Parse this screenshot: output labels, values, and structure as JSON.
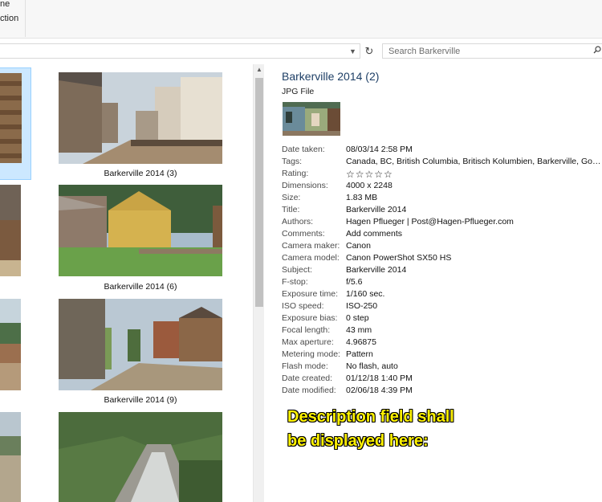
{
  "ribbon": {
    "cmd_top": "ne",
    "cmd_bottom": "ction"
  },
  "search": {
    "placeholder": "Search Barkerville",
    "icon": "search-icon"
  },
  "thumbnails": [
    {
      "caption": "Barkerville 2014 (3)"
    },
    {
      "caption": "Barkerville 2014 (6)"
    },
    {
      "caption": "Barkerville 2014 (9)"
    }
  ],
  "details": {
    "title": "Barkerville 2014 (2)",
    "type": "JPG File",
    "properties": [
      {
        "label": "Date taken:",
        "value": "08/03/14 2:58 PM"
      },
      {
        "label": "Tags:",
        "value": "Canada, BC, British Columbia, Britisch Kolumbien, Barkerville, Gold, Go..."
      },
      {
        "label": "Rating:",
        "value": "☆☆☆☆☆"
      },
      {
        "label": "Dimensions:",
        "value": "4000 x 2248"
      },
      {
        "label": "Size:",
        "value": "1.83 MB"
      },
      {
        "label": "Title:",
        "value": "Barkerville 2014"
      },
      {
        "label": "Authors:",
        "value": "Hagen Pflueger | Post@Hagen-Pflueger.com"
      },
      {
        "label": "Comments:",
        "value": "Add comments"
      },
      {
        "label": "Camera maker:",
        "value": "Canon"
      },
      {
        "label": "Camera model:",
        "value": "Canon PowerShot SX50 HS"
      },
      {
        "label": "Subject:",
        "value": "Barkerville 2014"
      },
      {
        "label": "F-stop:",
        "value": "f/5.6"
      },
      {
        "label": "Exposure time:",
        "value": "1/160 sec."
      },
      {
        "label": "ISO speed:",
        "value": "ISO-250"
      },
      {
        "label": "Exposure bias:",
        "value": "0 step"
      },
      {
        "label": "Focal length:",
        "value": "43 mm"
      },
      {
        "label": "Max aperture:",
        "value": "4.96875"
      },
      {
        "label": "Metering mode:",
        "value": "Pattern"
      },
      {
        "label": "Flash mode:",
        "value": "No flash, auto"
      },
      {
        "label": "Date created:",
        "value": "01/12/18 1:40 PM"
      },
      {
        "label": "Date modified:",
        "value": "02/06/18 4:39 PM"
      }
    ],
    "callout_line1": "Description field shall",
    "callout_line2": "be displayed here:"
  }
}
